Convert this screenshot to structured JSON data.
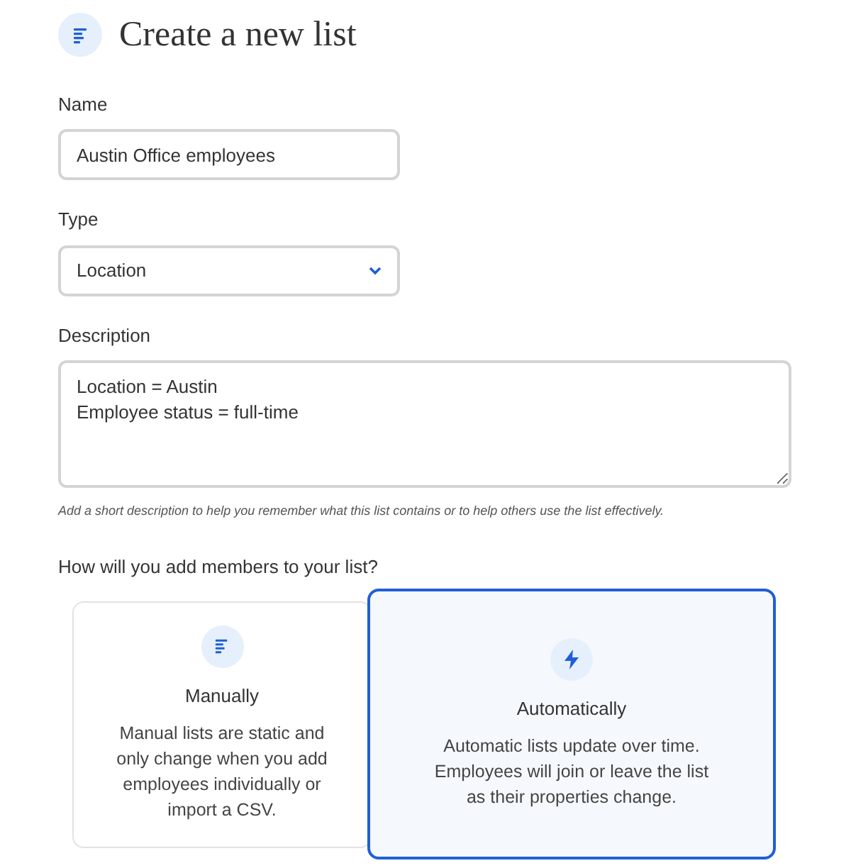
{
  "title": "Create a new list",
  "name_field": {
    "label": "Name",
    "value": "Austin Office employees"
  },
  "type_field": {
    "label": "Type",
    "value": "Location"
  },
  "description_field": {
    "label": "Description",
    "lines": [
      "Location = Austin",
      "Employee status = full-time"
    ],
    "hint": "Add a short description to help you remember what this list contains or to help others use the list effectively."
  },
  "members": {
    "question": "How will you add members to your list?",
    "options": [
      {
        "kind": "manual",
        "title": "Manually",
        "text": "Manual lists are static and only change when you add employees individually or import a CSV.",
        "selected": false
      },
      {
        "kind": "automatic",
        "title": "Automatically",
        "text": "Automatic lists update over time. Employees will join or leave the list as their properties change.",
        "selected": true
      }
    ]
  }
}
